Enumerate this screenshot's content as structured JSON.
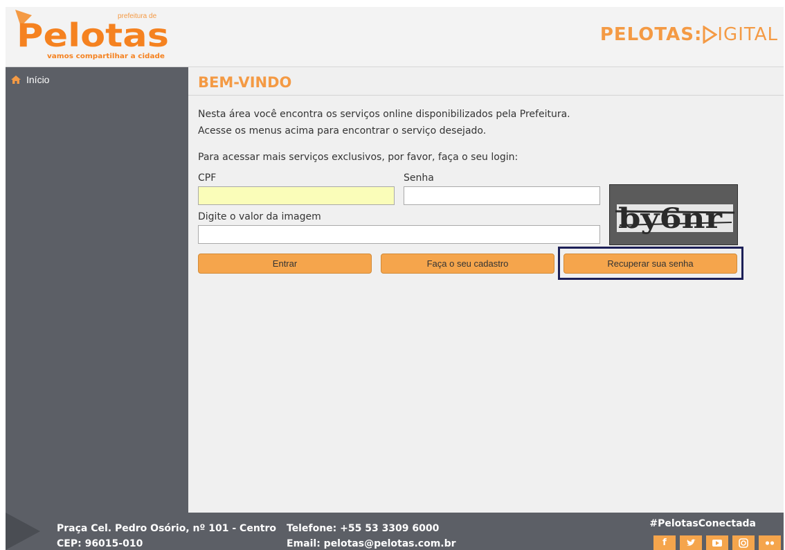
{
  "header": {
    "logo_left_alt": "Pelotas",
    "logo_left_small": "prefeitura de",
    "logo_left_slogan": "vamos compartilhar a cidade",
    "logo_right_prefix": "PELOTAS:",
    "logo_right_suffix": "IGITAL"
  },
  "sidebar": {
    "items": [
      {
        "label": "Início",
        "icon": "home-icon"
      }
    ]
  },
  "main": {
    "title": "BEM-VINDO",
    "intro_line1": "Nesta área você encontra os serviços online disponibilizados pela Prefeitura.",
    "intro_line2": "Acesse os menus acima para encontrar o serviço desejado.",
    "login_hint": "Para acessar mais serviços exclusivos, por favor, faça o seu login:",
    "form": {
      "cpf_label": "CPF",
      "cpf_value": "",
      "senha_label": "Senha",
      "senha_value": "",
      "captcha_label": "Digite o valor da imagem",
      "captcha_value": "",
      "captcha_text": "by6nr"
    },
    "buttons": {
      "entrar": "Entrar",
      "cadastro": "Faça o seu cadastro",
      "recuperar": "Recuperar sua senha"
    }
  },
  "footer": {
    "address_line1": "Praça Cel. Pedro Osório, nº 101 - Centro",
    "address_line2": "CEP: 96015-010",
    "phone": "Telefone: +55 53 3309 6000",
    "email": "Email: pelotas@pelotas.com.br",
    "hashtag": "#PelotasConectada",
    "socials": [
      "facebook-icon",
      "twitter-icon",
      "youtube-icon",
      "instagram-icon",
      "flickr-icon"
    ]
  },
  "colors": {
    "accent": "#f49a44",
    "sidebar_bg": "#5c5f66",
    "button_bg": "#f5a54c",
    "cpf_field_bg": "#fafdb9",
    "focus_ring": "#1c1f57"
  }
}
